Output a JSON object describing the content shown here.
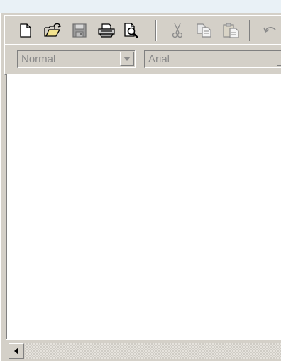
{
  "toolbar": {
    "buttons": [
      {
        "icon": "new-document-icon"
      },
      {
        "icon": "open-folder-icon"
      },
      {
        "icon": "save-icon"
      },
      {
        "icon": "print-icon"
      },
      {
        "icon": "print-preview-icon"
      },
      {
        "icon": "cut-icon"
      },
      {
        "icon": "copy-icon"
      },
      {
        "icon": "paste-icon"
      },
      {
        "icon": "undo-icon"
      }
    ]
  },
  "format": {
    "style_value": "Normal",
    "font_value": "Arial"
  },
  "colors": {
    "chrome": "#d4d0c8",
    "disabled_text": "#8a8a8a",
    "document": "#ffffff"
  }
}
